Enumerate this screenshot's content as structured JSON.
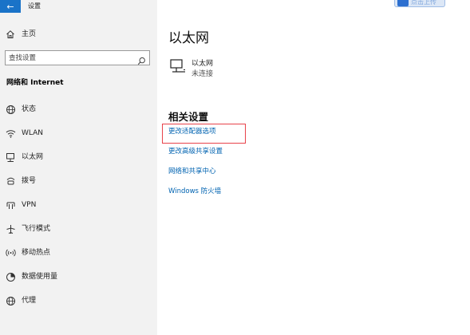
{
  "window": {
    "title": "设置",
    "back_glyph": "←"
  },
  "sidebar": {
    "home_label": "主页",
    "search_placeholder": "查找设置",
    "section_heading": "网络和 Internet",
    "items": [
      {
        "label": "状态",
        "icon": "globe-status-icon"
      },
      {
        "label": "WLAN",
        "icon": "wifi-icon"
      },
      {
        "label": "以太网",
        "icon": "ethernet-icon"
      },
      {
        "label": "拨号",
        "icon": "dialup-icon"
      },
      {
        "label": "VPN",
        "icon": "vpn-icon"
      },
      {
        "label": "飞行模式",
        "icon": "airplane-icon"
      },
      {
        "label": "移动热点",
        "icon": "hotspot-icon"
      },
      {
        "label": "数据使用量",
        "icon": "data-usage-icon"
      },
      {
        "label": "代理",
        "icon": "proxy-globe-icon"
      }
    ]
  },
  "main": {
    "page_title": "以太网",
    "network": {
      "name": "以太网",
      "status": "未连接"
    },
    "related_heading": "相关设置",
    "links": [
      "更改适配器选项",
      "更改高级共享设置",
      "网络和共享中心",
      "Windows 防火墙"
    ]
  },
  "float_widget": {
    "text": "点击上传"
  },
  "colors": {
    "accent": "#0063b1",
    "back_button": "#1a73c8",
    "sidebar_bg": "#f2f2f2",
    "highlight_border": "#e8424a"
  }
}
